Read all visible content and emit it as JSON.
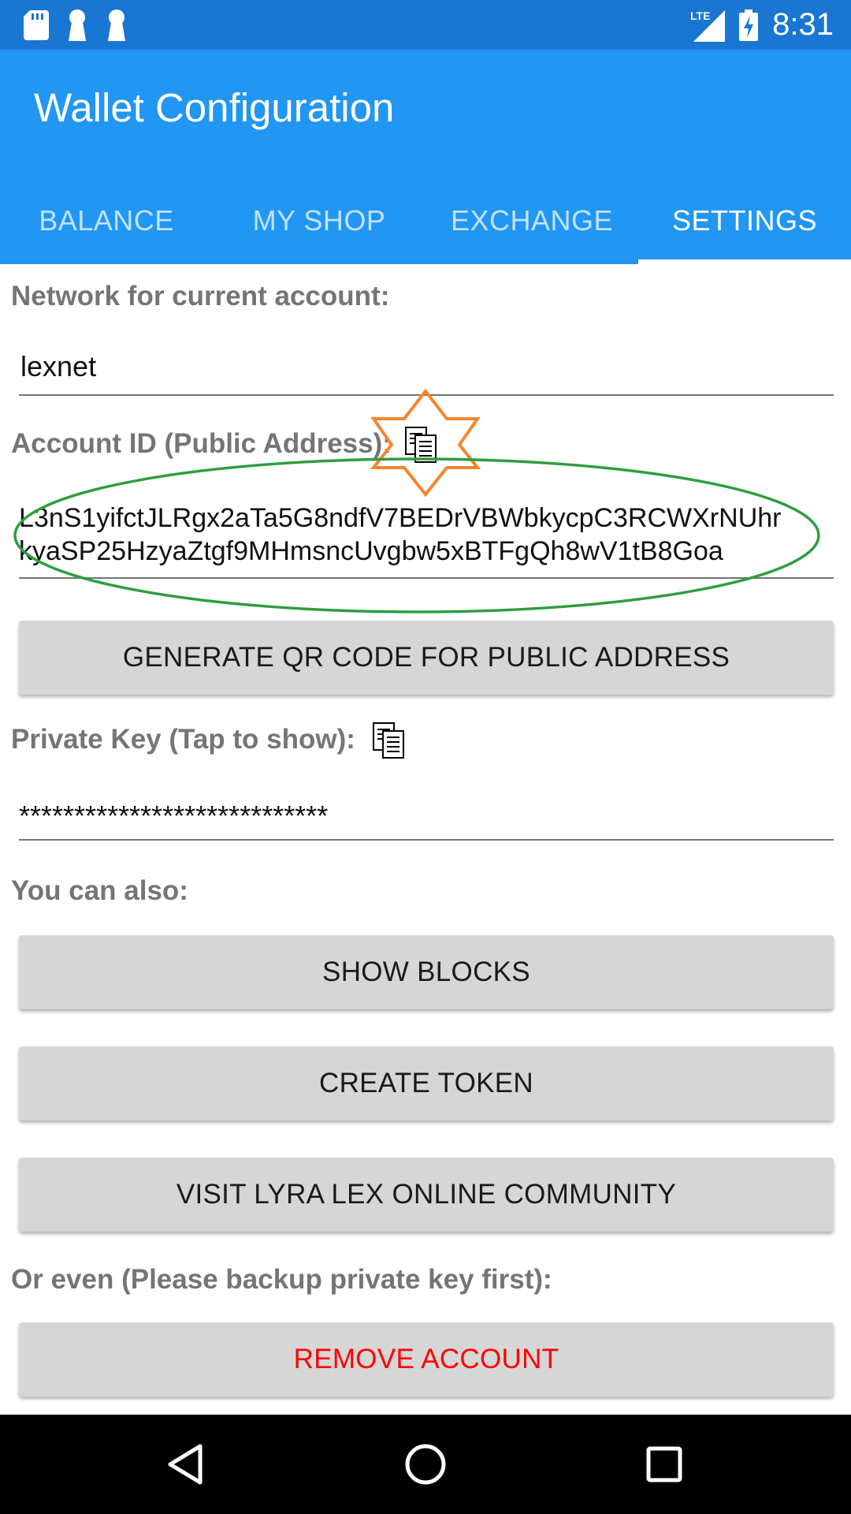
{
  "status_bar": {
    "time": "8:31",
    "network": "LTE",
    "icons": [
      "sd-card-icon",
      "keyhole-icon",
      "keyhole-icon",
      "signal-icon",
      "battery-charging-icon"
    ]
  },
  "app": {
    "title": "Wallet Configuration",
    "tabs": [
      {
        "label": "BALANCE"
      },
      {
        "label": "MY SHOP"
      },
      {
        "label": "EXCHANGE"
      },
      {
        "label": "SETTINGS",
        "active": true
      }
    ]
  },
  "settings": {
    "network_label": "Network for current account:",
    "network_value": "lexnet",
    "account_id_label": "Account ID (Public Address):",
    "account_id_line1": "L3nS1yifctJLRgx2aTa5G8ndfV7BEDrVBWbkycpC3RCWXrNUhr",
    "account_id_line2": "kyaSP25HzyaZtgf9MHmsncUvgbw5xBTFgQh8wV1tB8Goa",
    "generate_qr_button": "GENERATE QR CODE FOR PUBLIC ADDRESS",
    "private_key_label": "Private Key (Tap to show):",
    "private_key_value": "****************************",
    "also_label": "You can also:",
    "show_blocks_button": "SHOW BLOCKS",
    "create_token_button": "CREATE TOKEN",
    "visit_community_button": "VISIT LYRA LEX ONLINE COMMUNITY",
    "or_even_label": "Or even (Please backup private key first):",
    "remove_account_button": "REMOVE ACCOUNT"
  },
  "colors": {
    "status_bar": "#1976D2",
    "app_bar": "#2196F3",
    "button_bg": "#D6D6D6",
    "danger": "#FF0000",
    "annotation_star": "#F5862E",
    "annotation_ellipse": "#2E9E3E"
  },
  "nav": {
    "icons": [
      "back-icon",
      "home-icon",
      "recents-icon"
    ]
  }
}
